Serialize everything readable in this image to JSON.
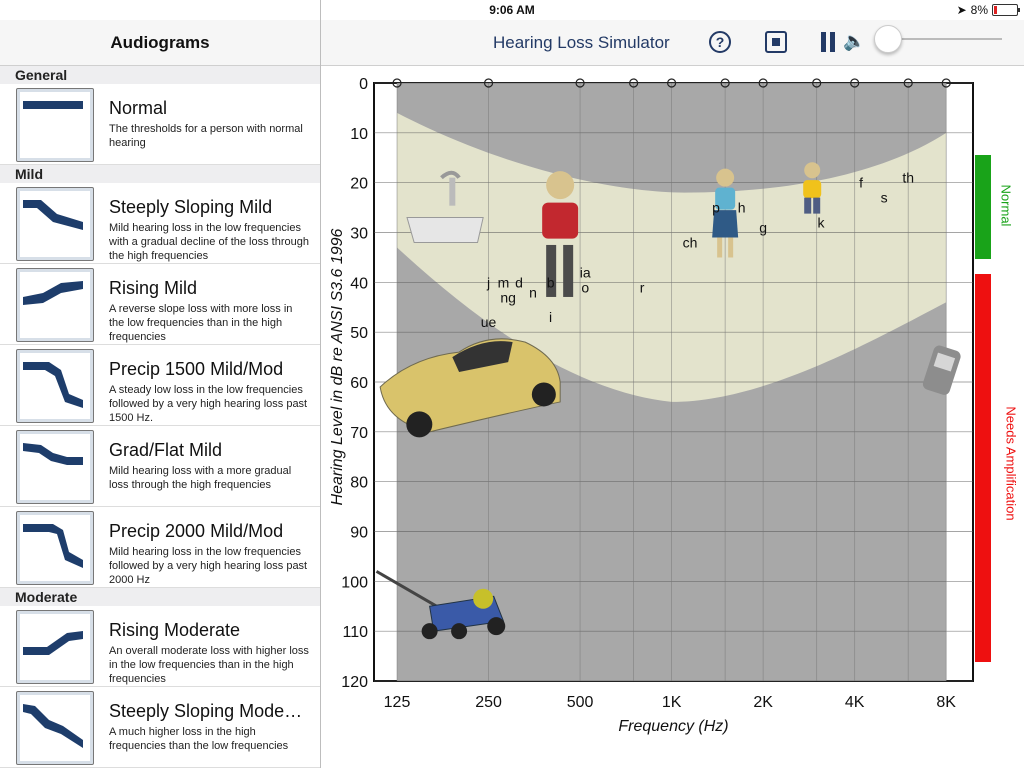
{
  "status": {
    "device": "iPad",
    "time": "9:06 AM",
    "battery": "8%"
  },
  "sidebar": {
    "title": "Audiograms",
    "sections": [
      {
        "label": "General",
        "items": [
          {
            "title": "Normal",
            "desc": "The thresholds for a person with normal hearing",
            "shape": "normal"
          }
        ]
      },
      {
        "label": "Mild",
        "items": [
          {
            "title": "Steeply Sloping Mild",
            "desc": "Mild hearing loss in the low frequencies with a gradual decline of the loss through the high frequencies",
            "shape": "steep"
          },
          {
            "title": "Rising Mild",
            "desc": "A reverse slope loss with more loss in the low frequencies than in the high frequencies",
            "shape": "rising"
          },
          {
            "title": "Precip 1500 Mild/Mod",
            "desc": "A steady low loss in the low frequencies followed by a very high hearing loss past 1500 Hz.",
            "shape": "precip"
          },
          {
            "title": "Grad/Flat Mild",
            "desc": "Mild hearing loss with a more gradual loss through the high frequencies",
            "shape": "grad"
          },
          {
            "title": "Precip 2000 Mild/Mod",
            "desc": "Mild hearing loss in the low frequencies followed by a very high hearing loss past 2000 Hz",
            "shape": "precip2"
          }
        ]
      },
      {
        "label": "Moderate",
        "items": [
          {
            "title": "Rising Moderate",
            "desc": "An overall moderate loss with higher loss in the low frequencies than in the high frequencies",
            "shape": "risingmod"
          },
          {
            "title": "Steeply Sloping Mode…",
            "desc": "A much higher loss in the high frequencies than the low frequencies",
            "shape": "steepmod"
          }
        ]
      }
    ]
  },
  "toolbar": {
    "title": "Hearing Loss Simulator",
    "help": "?",
    "icons": [
      "help-icon",
      "record-icon",
      "pause-icon",
      "volume-icon"
    ]
  },
  "chart_data": {
    "type": "scatter",
    "ylabel": "Hearing Level in dB re ANSI S3.6 1996",
    "xlabel": "Frequency (Hz)",
    "x_tick_labels": [
      "125",
      "250",
      "500",
      "1K",
      "2K",
      "4K",
      "8K"
    ],
    "x_ticks_hz": [
      125,
      250,
      500,
      1000,
      2000,
      4000,
      8000
    ],
    "x_threshold_markers_hz": [
      125,
      250,
      500,
      750,
      1000,
      1500,
      2000,
      3000,
      4000,
      6000,
      8000
    ],
    "y_ticks": [
      0,
      10,
      20,
      30,
      40,
      50,
      60,
      70,
      80,
      90,
      100,
      110,
      120
    ],
    "ylim": [
      0,
      120
    ],
    "normal_thresholds_db": [
      0,
      0,
      0,
      0,
      0,
      0,
      0,
      0,
      0,
      0,
      0
    ],
    "speech_sounds": [
      {
        "text": "j",
        "hz": 250,
        "db": 40
      },
      {
        "text": "m",
        "hz": 280,
        "db": 40
      },
      {
        "text": "d",
        "hz": 315,
        "db": 40
      },
      {
        "text": "b",
        "hz": 400,
        "db": 40
      },
      {
        "text": "ng",
        "hz": 290,
        "db": 43
      },
      {
        "text": "n",
        "hz": 350,
        "db": 42
      },
      {
        "text": "ia",
        "hz": 520,
        "db": 38
      },
      {
        "text": "o",
        "hz": 520,
        "db": 41
      },
      {
        "text": "r",
        "hz": 800,
        "db": 41
      },
      {
        "text": "ue",
        "hz": 250,
        "db": 48
      },
      {
        "text": "i",
        "hz": 400,
        "db": 47
      },
      {
        "text": "p",
        "hz": 1400,
        "db": 25
      },
      {
        "text": "h",
        "hz": 1700,
        "db": 25
      },
      {
        "text": "ch",
        "hz": 1150,
        "db": 32
      },
      {
        "text": "g",
        "hz": 2000,
        "db": 29
      },
      {
        "text": "k",
        "hz": 3100,
        "db": 28
      },
      {
        "text": "f",
        "hz": 4200,
        "db": 20
      },
      {
        "text": "th",
        "hz": 6000,
        "db": 19
      },
      {
        "text": "s",
        "hz": 5000,
        "db": 23
      }
    ],
    "speech_banana": "speech-banana",
    "images": [
      "faucet-icon",
      "man-icon",
      "woman-icon",
      "child-icon",
      "car-icon",
      "phone-icon",
      "lawnmower-icon"
    ],
    "side_labels": {
      "normal": "Normal",
      "needs": "Needs Amplification"
    },
    "colors": {
      "normal": "#19a319",
      "needs": "#ee1010",
      "banana": "#e8e8cf",
      "plot": "#a8a8a8"
    }
  }
}
